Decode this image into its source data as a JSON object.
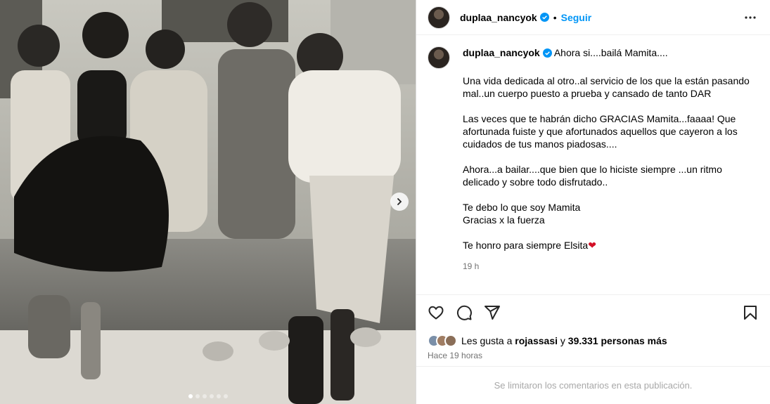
{
  "post": {
    "username": "duplaa_nancyok",
    "follow_label": "Seguir",
    "separator": "•"
  },
  "caption": {
    "username": "duplaa_nancyok",
    "first_line": "Ahora si....bailá Mamita....",
    "paragraphs": [
      [
        "Una vida dedicada al otro..al servicio de los que la están pasando",
        "mal..un cuerpo puesto a prueba y cansado de tanto DAR"
      ],
      [
        "Las veces que te habrán dicho GRACIAS Mamita...faaaa! Que",
        "afortunada fuiste y que afortunados aquellos que cayeron a los",
        "cuidados de tus manos piadosas...."
      ],
      [
        "Ahora...a bailar....que bien que lo hiciste siempre ...un ritmo",
        "delicado y sobre todo disfrutado.."
      ],
      [
        "Te debo lo que soy Mamita",
        "Gracias x la fuerza"
      ]
    ],
    "last_line": "Te honro para siempre Elsita",
    "last_emoji": "❤",
    "time": "19 h"
  },
  "likes": {
    "prefix": "Les gusta a",
    "user": "rojassasi",
    "middle": "y",
    "count": "39.331 personas más"
  },
  "ago": "Hace 19 horas",
  "comments_limited": "Se limitaron los comentarios en esta publicación.",
  "carousel": {
    "total": 6,
    "active_index": 0
  },
  "colors": {
    "accent": "#0095f6",
    "verified": "#0095f6",
    "heart": "#d31027",
    "muted": "#737373"
  },
  "icons": [
    "more-options-icon",
    "verified-icon",
    "like-icon",
    "comment-icon",
    "share-icon",
    "save-icon",
    "chevron-right-icon"
  ]
}
